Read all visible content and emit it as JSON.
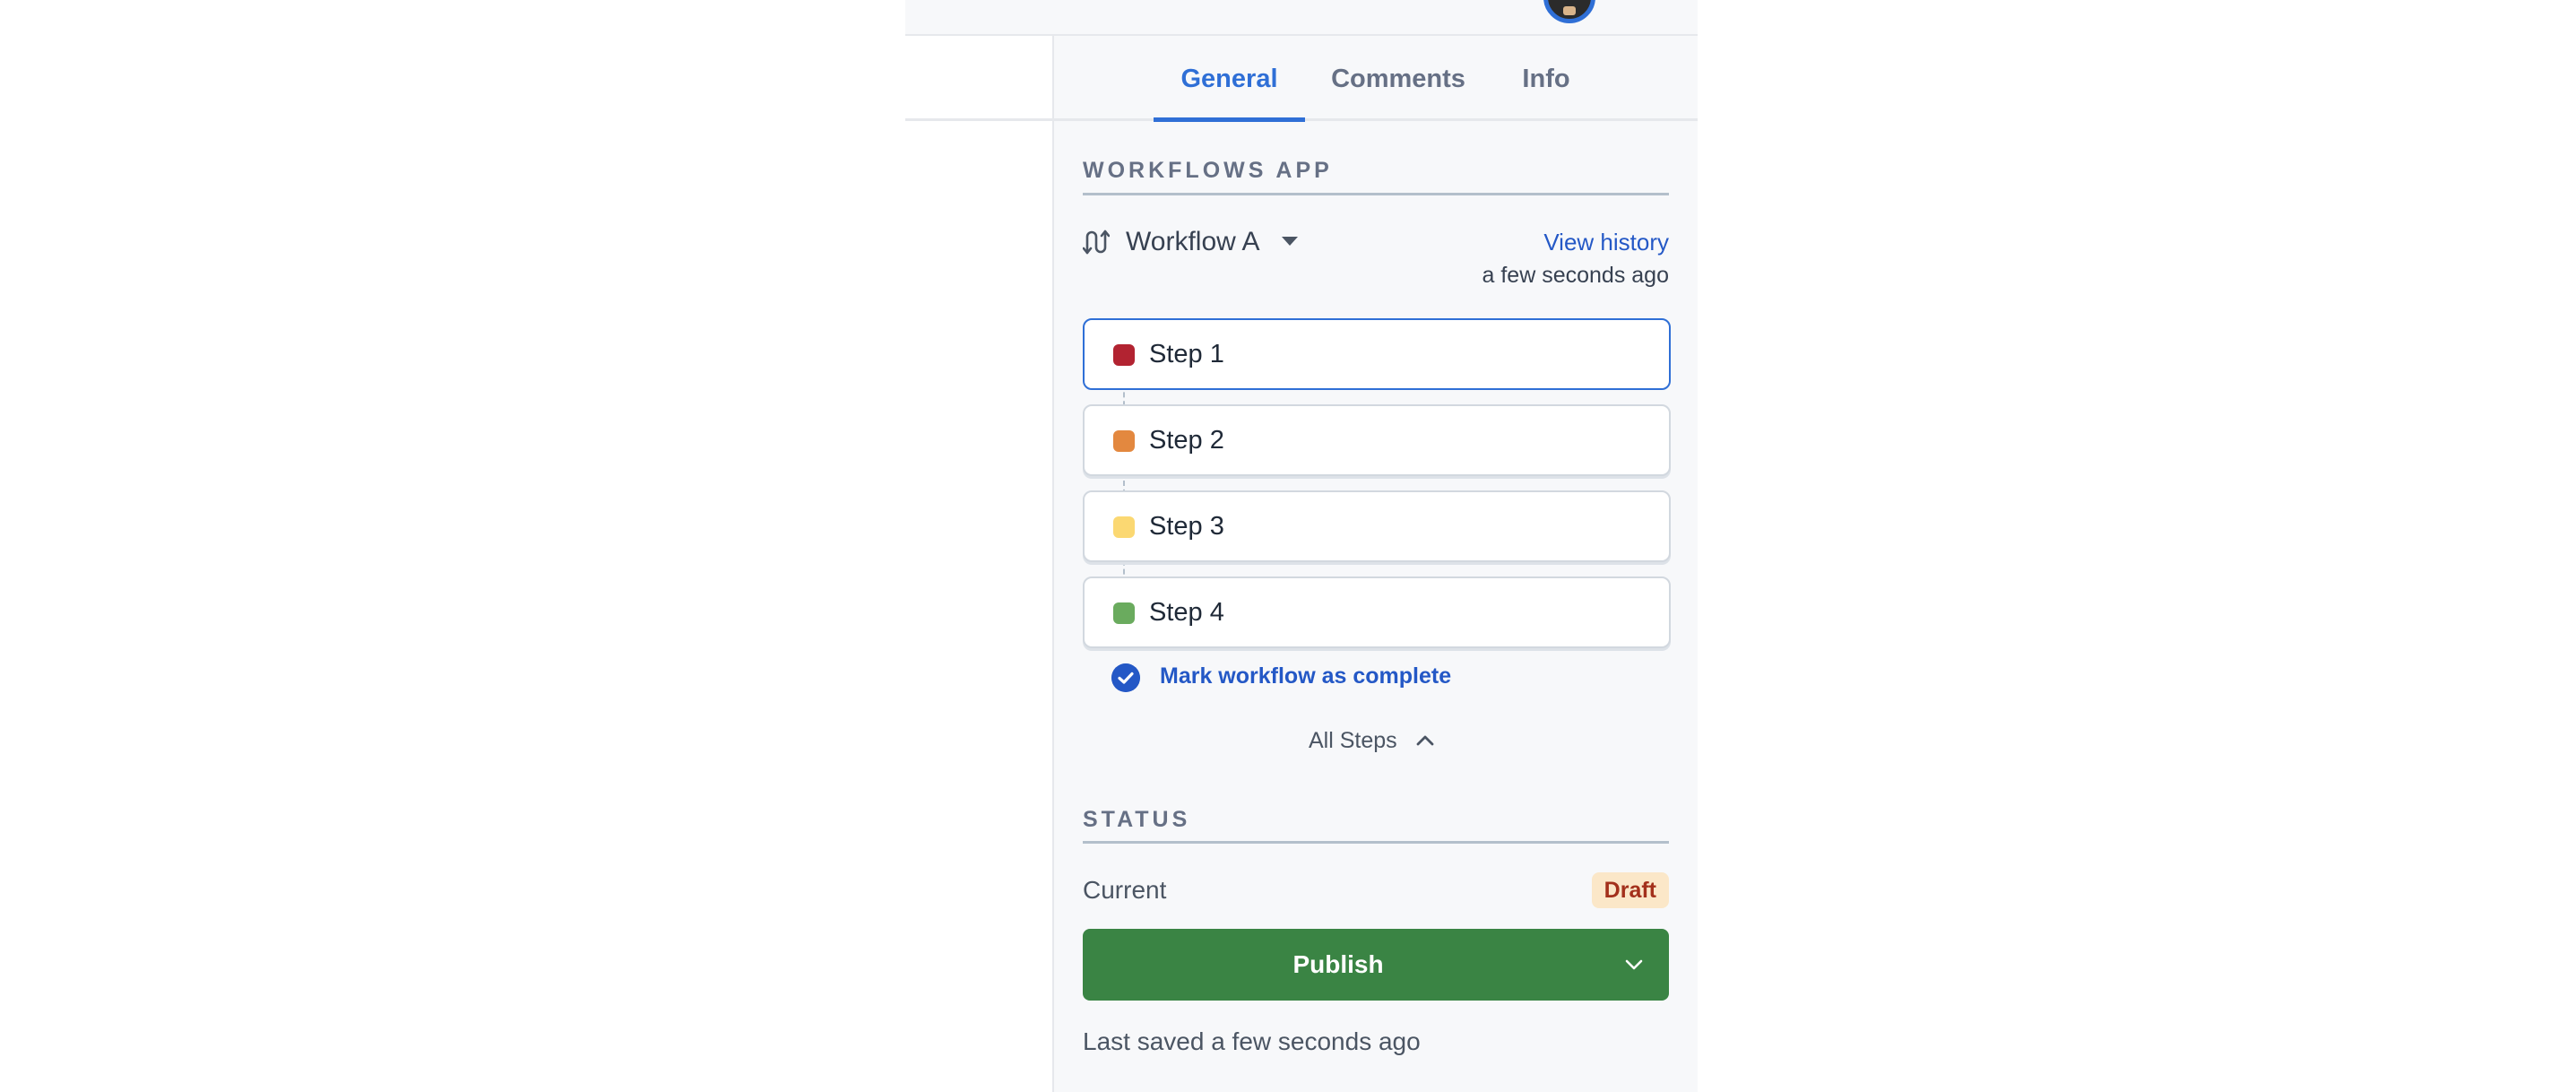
{
  "tabs": [
    {
      "label": "General",
      "active": true
    },
    {
      "label": "Comments",
      "active": false
    },
    {
      "label": "Info",
      "active": false
    }
  ],
  "workflows_section": {
    "title": "WORKFLOWS APP",
    "workflow_icon": "workflow-icon",
    "workflow_name": "Workflow A",
    "view_history_label": "View history",
    "history_time": "a few seconds ago",
    "steps": [
      {
        "label": "Step 1",
        "color": "#b22331",
        "selected": true
      },
      {
        "label": "Step 2",
        "color": "#e3883f",
        "selected": false
      },
      {
        "label": "Step 3",
        "color": "#fbd872",
        "selected": false
      },
      {
        "label": "Step 4",
        "color": "#6aab5e",
        "selected": false
      }
    ],
    "mark_complete_label": "Mark workflow as complete",
    "all_steps_label": "All Steps"
  },
  "status_section": {
    "title": "STATUS",
    "current_label": "Current",
    "current_value": "Draft",
    "publish_label": "Publish",
    "last_saved": "Last saved a few seconds ago"
  },
  "colors": {
    "accent": "#2f6fd6",
    "link": "#2458c6",
    "publish": "#3a8444",
    "draft_bg": "#fbe7c8",
    "draft_text": "#a3301b"
  }
}
